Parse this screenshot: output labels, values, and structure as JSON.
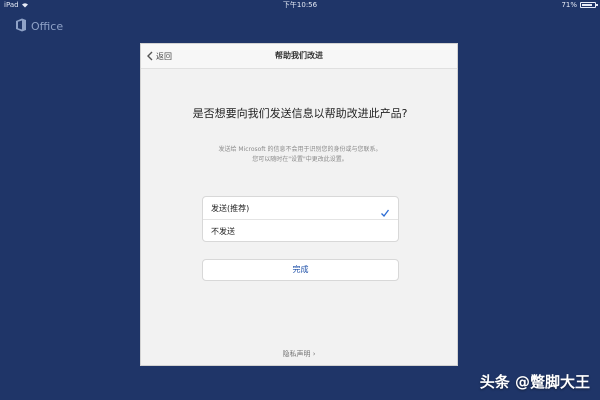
{
  "status_bar": {
    "device": "iPad",
    "time": "下午10:56",
    "battery": "71%"
  },
  "app": {
    "name": "Office"
  },
  "dialog": {
    "back_label": "返回",
    "title": "帮助我们改进",
    "question": "是否想要向我们发送信息以帮助改进此产品?",
    "description_line1": "发送给 Microsoft 的信息不会用于识别您的身份或与您联系。",
    "description_line2": "您可以随时在\"设置\"中更改此设置。",
    "options": [
      {
        "label": "发送(推荐)",
        "selected": true
      },
      {
        "label": "不发送",
        "selected": false
      }
    ],
    "done_label": "完成",
    "privacy_link": "隐私声明 ›"
  },
  "watermark": "头条 @蹩脚大王",
  "colors": {
    "background": "#1f3568",
    "accent": "#1d4fa8"
  },
  "icons": [
    "wifi-icon",
    "battery-icon",
    "office-logo-icon",
    "chevron-left-icon",
    "checkmark-icon"
  ]
}
